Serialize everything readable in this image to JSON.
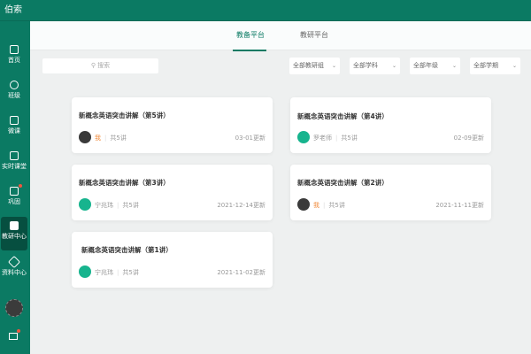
{
  "app": {
    "title": "伯索"
  },
  "sidebar": {
    "items": [
      {
        "label": "首页",
        "icon": "home-icon"
      },
      {
        "label": "班级",
        "icon": "users-icon"
      },
      {
        "label": "微课",
        "icon": "video-icon"
      },
      {
        "label": "实时课堂",
        "icon": "classroom-icon"
      },
      {
        "label": "巩固",
        "icon": "homework-icon",
        "badge": true
      },
      {
        "label": "教研中心",
        "icon": "research-icon",
        "active": true
      },
      {
        "label": "资料中心",
        "icon": "layers-icon"
      }
    ]
  },
  "tabs": [
    {
      "label": "教备平台",
      "active": true
    },
    {
      "label": "教研平台"
    }
  ],
  "search": {
    "placeholder": "搜索"
  },
  "filters": [
    "全部教研组",
    "全部学科",
    "全部年级",
    "全部学期"
  ],
  "cards": [
    {
      "title": "新概念英语突击讲解（第5讲）",
      "author": "我",
      "is_me": true,
      "count": "共5讲",
      "date": "03-01更新"
    },
    {
      "title": "新概念英语突击讲解（第4讲）",
      "author": "罗老师",
      "count": "共5讲",
      "date": "02-09更新"
    },
    {
      "title": "新概念英语突击讲解（第3讲）",
      "author": "宁兆玮",
      "count": "共5讲",
      "date": "2021-12-14更新"
    },
    {
      "title": "新概念英语突击讲解（第2讲）",
      "author": "我",
      "is_me": true,
      "count": "共5讲",
      "date": "2021-11-11更新"
    },
    {
      "title": "新概念英语突击讲解（第1讲）",
      "author": "宁兆玮",
      "count": "共5讲",
      "date": "2021-11-02更新"
    }
  ],
  "colors": {
    "brand": "#0b7a63",
    "accent_me": "#f08a3a",
    "avatar_green": "#17b48e"
  }
}
